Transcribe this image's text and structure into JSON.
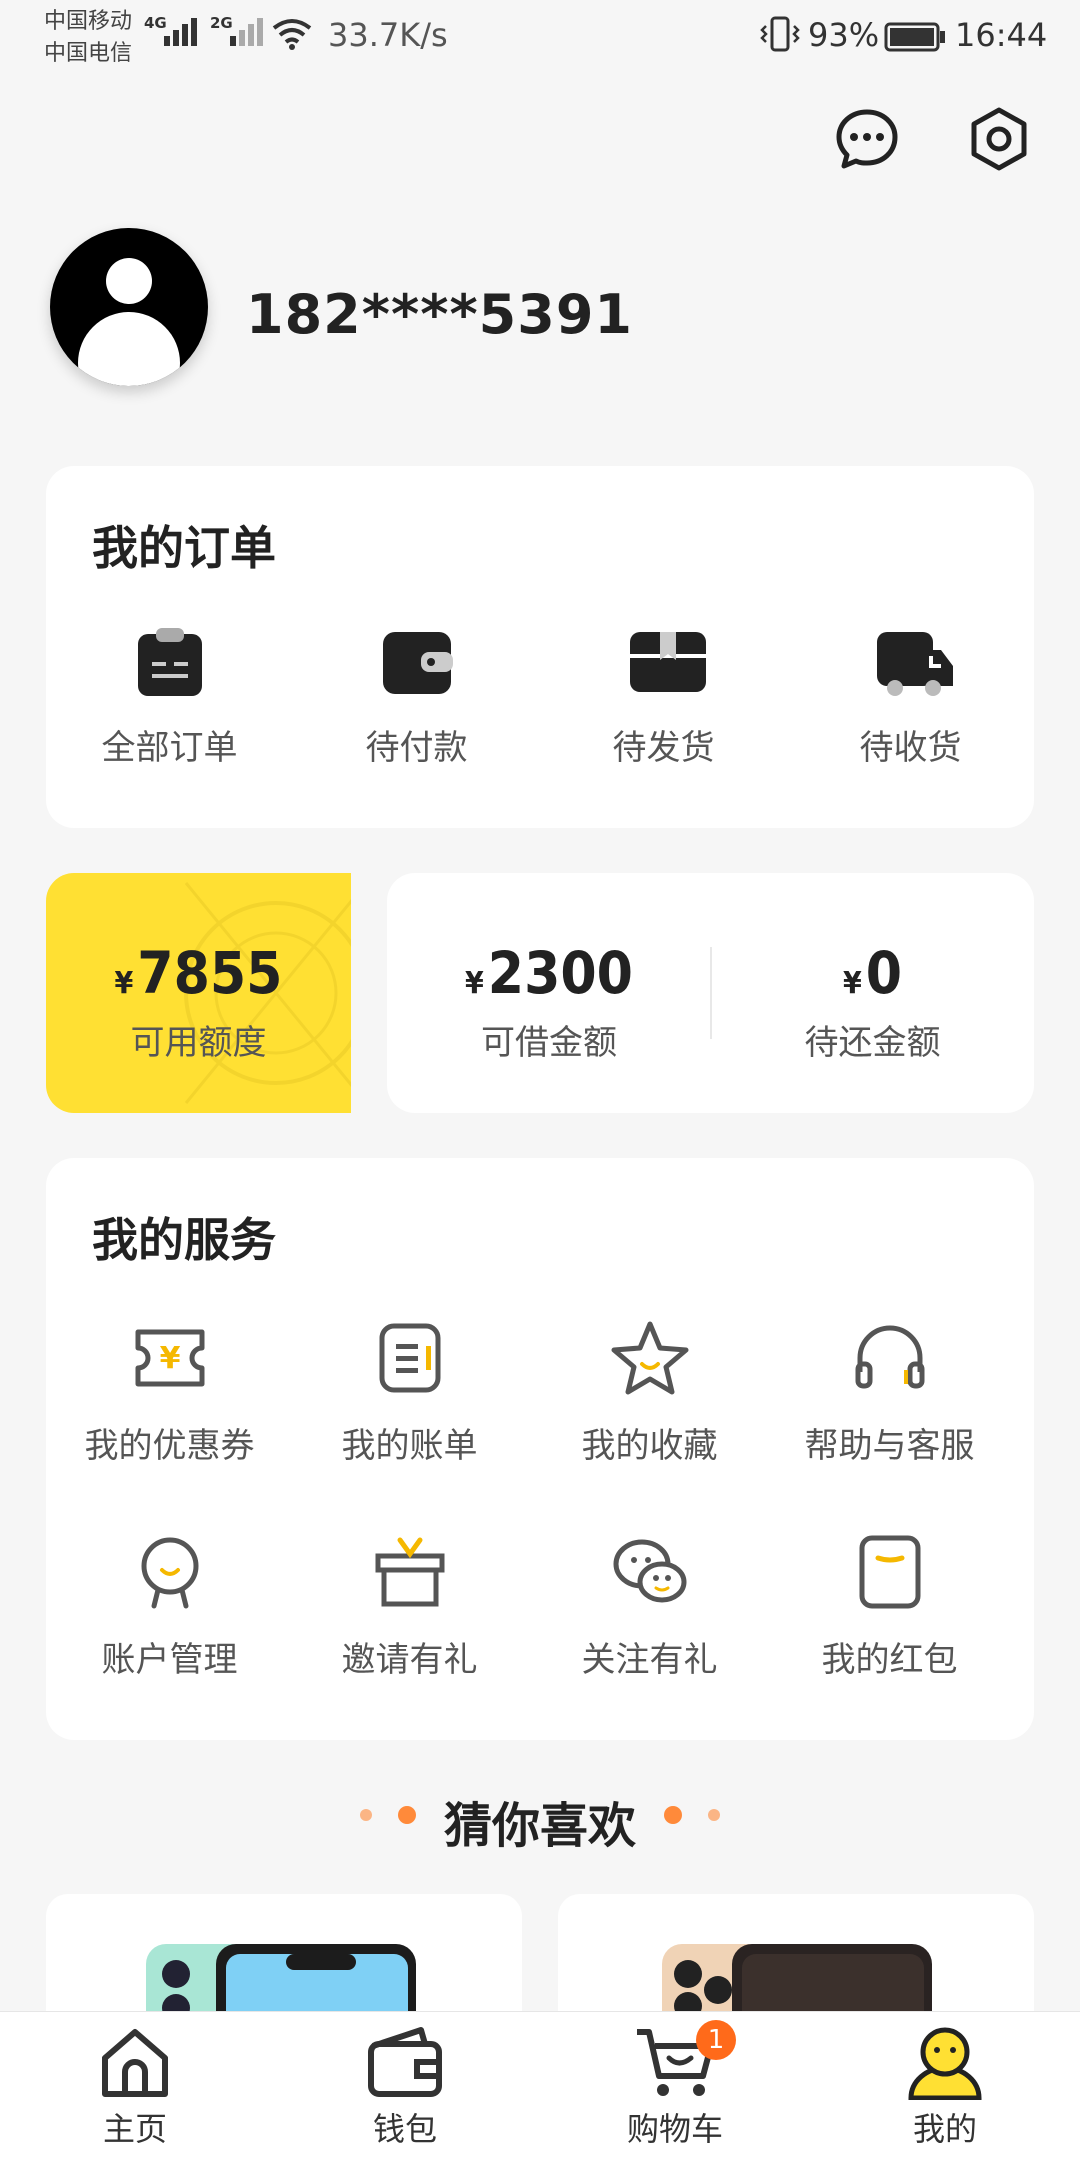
{
  "status_bar": {
    "carrier1": "中国移动",
    "carrier2": "中国电信",
    "net1": "4G",
    "net2": "2G",
    "speed": "33.7K/s",
    "battery": "93%",
    "time": "16:44"
  },
  "header": {
    "icons": [
      "chat-icon",
      "settings-icon"
    ]
  },
  "profile": {
    "phone": "182****5391"
  },
  "orders": {
    "title": "我的订单",
    "items": [
      {
        "label": "全部订单",
        "icon": "clipboard-icon"
      },
      {
        "label": "待付款",
        "icon": "wallet-icon"
      },
      {
        "label": "待发货",
        "icon": "box-icon"
      },
      {
        "label": "待收货",
        "icon": "truck-icon"
      }
    ]
  },
  "credit": {
    "currency": "¥",
    "available": {
      "value": "7855",
      "label": "可用额度"
    },
    "borrowable": {
      "value": "2300",
      "label": "可借金额"
    },
    "repay": {
      "value": "0",
      "label": "待还金额"
    }
  },
  "services": {
    "title": "我的服务",
    "items": [
      {
        "label": "我的优惠券",
        "icon": "coupon-icon"
      },
      {
        "label": "我的账单",
        "icon": "bill-icon"
      },
      {
        "label": "我的收藏",
        "icon": "star-icon"
      },
      {
        "label": "帮助与客服",
        "icon": "headset-icon"
      },
      {
        "label": "账户管理",
        "icon": "account-icon"
      },
      {
        "label": "邀请有礼",
        "icon": "gift-icon"
      },
      {
        "label": "关注有礼",
        "icon": "wechat-icon"
      },
      {
        "label": "我的红包",
        "icon": "red-packet-icon"
      }
    ]
  },
  "recommend": {
    "title": "猜你喜欢"
  },
  "tabbar": {
    "items": [
      {
        "label": "主页",
        "icon": "home-icon"
      },
      {
        "label": "钱包",
        "icon": "wallet-tab-icon"
      },
      {
        "label": "购物车",
        "icon": "cart-icon",
        "badge": "1"
      },
      {
        "label": "我的",
        "icon": "me-icon"
      }
    ],
    "active_index": 3
  },
  "colors": {
    "accent": "#ffe033",
    "badge": "#ff6a1a",
    "icon_accent": "#f5b800"
  }
}
